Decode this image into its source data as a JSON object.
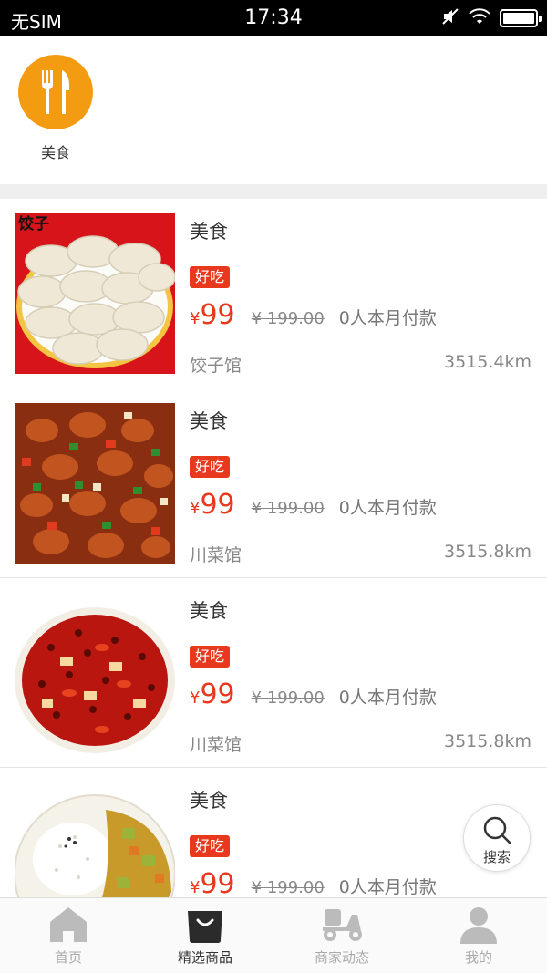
{
  "status_bar": {
    "carrier": "无SIM",
    "time": "17:34",
    "battery_level": 1.0
  },
  "category": {
    "label": "美食",
    "icon": "fork-knife-icon",
    "color": "#f39c12"
  },
  "colors": {
    "accent": "#e8381e",
    "divider": "#efefef"
  },
  "products": [
    {
      "title": "美食",
      "tag": "好吃",
      "currency": "¥",
      "price": "99",
      "original_price": "¥ 199.00",
      "sales": "0人本月付款",
      "shop": "饺子馆",
      "distance": "3515.4km",
      "thumb_caption": "饺子",
      "image": "dumplings"
    },
    {
      "title": "美食",
      "tag": "好吃",
      "currency": "¥",
      "price": "99",
      "original_price": "¥ 199.00",
      "sales": "0人本月付款",
      "shop": "川菜馆",
      "distance": "3515.8km",
      "image": "spicy-chicken-stirfry"
    },
    {
      "title": "美食",
      "tag": "好吃",
      "currency": "¥",
      "price": "99",
      "original_price": "¥ 199.00",
      "sales": "0人本月付款",
      "shop": "川菜馆",
      "distance": "3515.8km",
      "image": "chili-oil-fish"
    },
    {
      "title": "美食",
      "tag": "好吃",
      "currency": "¥",
      "price": "99",
      "original_price": "¥ 199.00",
      "sales": "0人本月付款",
      "image": "curry-rice"
    }
  ],
  "search_button": {
    "label": "搜索",
    "icon": "search-icon"
  },
  "tabbar": [
    {
      "label": "首页",
      "icon": "home-icon",
      "active": false
    },
    {
      "label": "精选商品",
      "icon": "shopping-bag-icon",
      "active": true
    },
    {
      "label": "商家动态",
      "icon": "scooter-icon",
      "active": false
    },
    {
      "label": "我的",
      "icon": "user-icon",
      "active": false
    }
  ]
}
